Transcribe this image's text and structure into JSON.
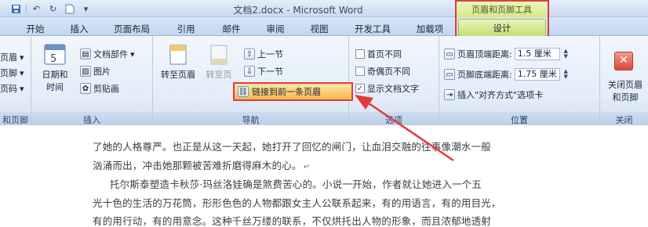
{
  "window": {
    "title": "文档2.docx - Microsoft Word",
    "contextual_header": "页眉和页脚工具"
  },
  "quick_access": {
    "icons": [
      "save-icon",
      "undo-icon",
      "redo-icon",
      "new-doc-icon",
      "dropdown-icon"
    ]
  },
  "tabs": {
    "start": "开始",
    "insert": "插入",
    "page_layout": "页面布局",
    "references": "引用",
    "mailings": "邮件",
    "review": "审阅",
    "view": "视图",
    "developer": "开发工具",
    "addins": "加载项",
    "design": "设计"
  },
  "ribbon": {
    "header_footer": {
      "label": "和页脚",
      "items": [
        "页眉",
        "页脚",
        "页码"
      ]
    },
    "insert": {
      "label": "插入",
      "date_time": [
        "日期和",
        "时间"
      ],
      "doc_parts": "文档部件",
      "picture": "图片",
      "clipart": "剪贴画"
    },
    "navigation": {
      "label": "导航",
      "goto_header": "转至页眉",
      "goto_footer": "转至页",
      "prev": "上一节",
      "next": "下一节",
      "link_prev": "链接到前一条页眉"
    },
    "options": {
      "label": "选项",
      "first_page": "首页不同",
      "odd_even": "奇偶页不同",
      "show_text": "显示文档文字"
    },
    "position": {
      "label": "位置",
      "header_dist_label": "页眉顶端距离:",
      "header_dist_value": "1.5 厘米",
      "footer_dist_label": "页脚底端距离:",
      "footer_dist_value": "1.75 厘米",
      "insert_align": "插入\"对齐方式\"选项卡"
    },
    "close": {
      "label": "关闭",
      "button": [
        "关闭页眉",
        "和页脚"
      ]
    }
  },
  "document": {
    "lines": [
      "了她的人格尊严。也正是从这一天起，她打开了回忆的闸门，让血泪交融的往事像潮水一般",
      "汹涌而出，冲击她那颗被苦难折磨得麻木的心。",
      "托尔斯泰塑造卡秋莎·玛丝洛娃确是煞费苦心的。小说一开始，作者就让她进入一个五",
      "光十色的生活的万花筒，形形色色的人物都跟女主人公联系起来，有的用语言，有的用目光，",
      "有的用行动，有的用意念。这种千丝万缕的联系，不仅烘托出人物的形象，而且浓郁地透射"
    ]
  },
  "colors": {
    "annotation_red": "#e03c3c",
    "contextual_green": "#c7de6f",
    "highlight_orange": "#f5b84a"
  }
}
